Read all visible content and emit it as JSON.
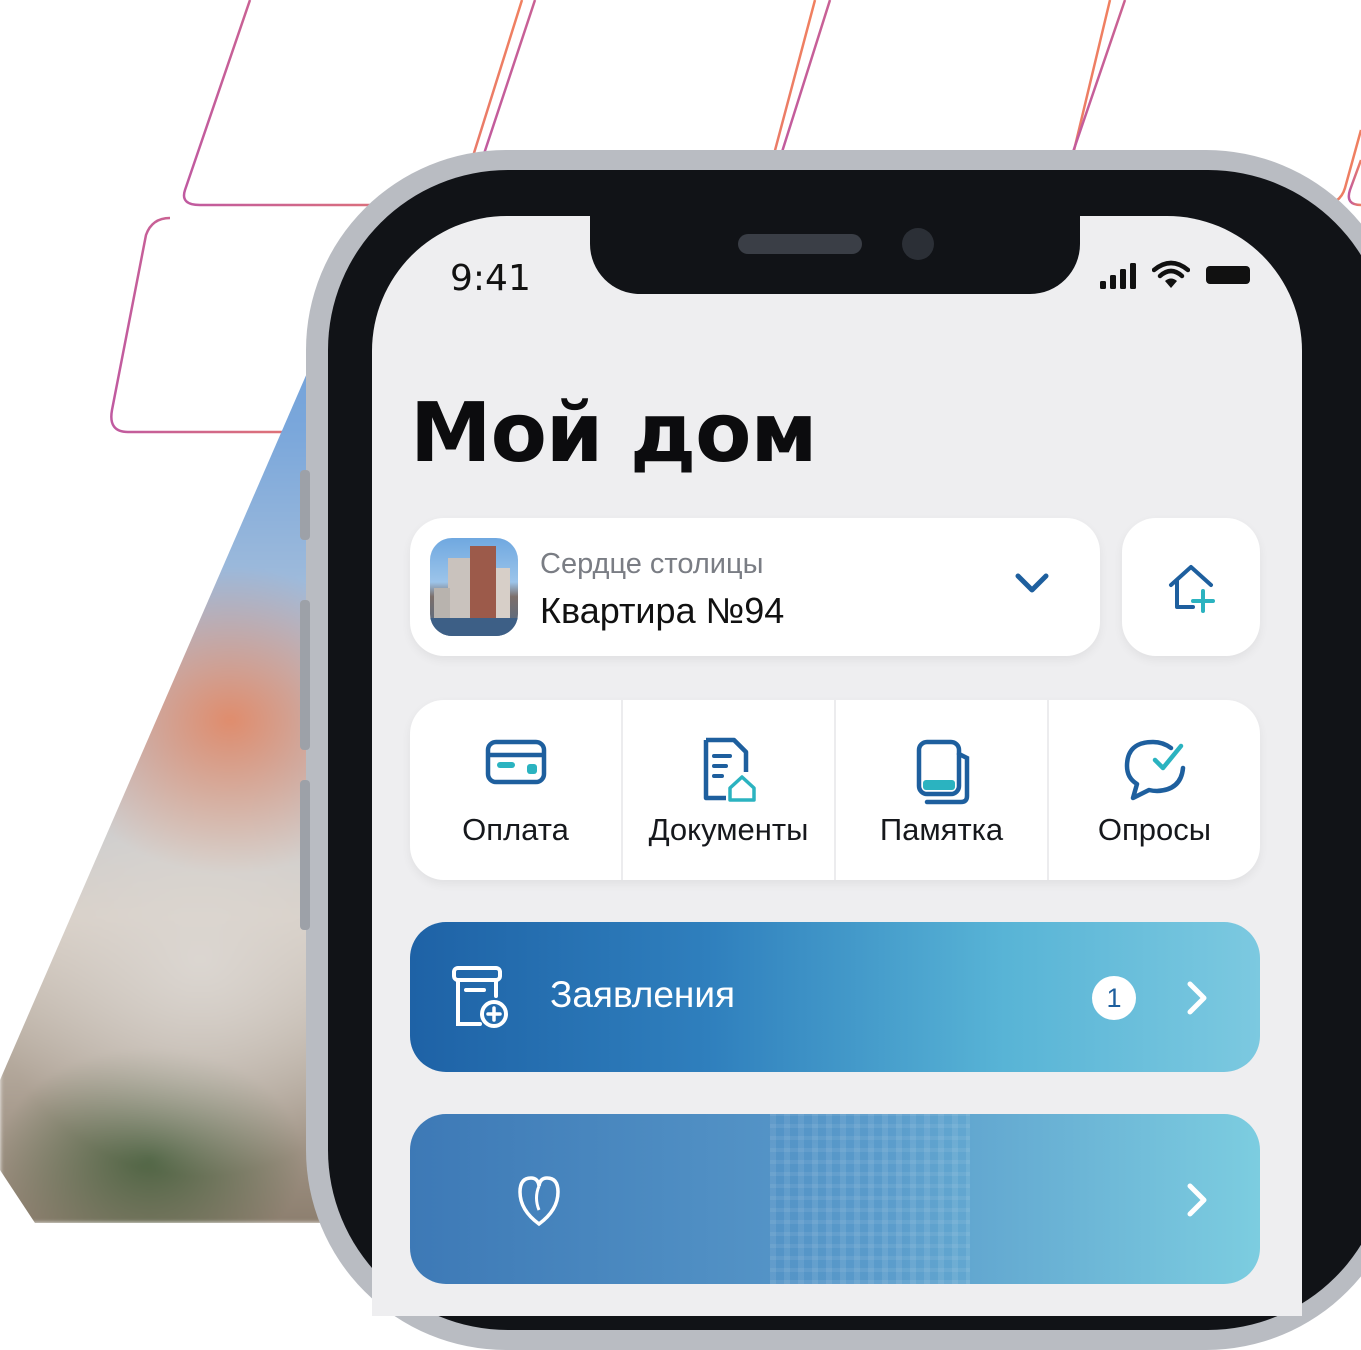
{
  "status_bar": {
    "time": "9:41"
  },
  "page": {
    "title": "Мой дом"
  },
  "apartment": {
    "complex": "Сердце столицы",
    "name": "Квартира №94"
  },
  "quick_actions": [
    {
      "label": "Оплата",
      "icon": "card-icon"
    },
    {
      "label": "Документы",
      "icon": "document-home-icon"
    },
    {
      "label": "Памятка",
      "icon": "memo-icon"
    },
    {
      "label": "Опросы",
      "icon": "poll-chat-icon"
    }
  ],
  "applications": {
    "label": "Заявления",
    "badge": "1"
  },
  "colors": {
    "accent": "#1e5f9e",
    "banner_start": "#1e62a6",
    "banner_end": "#7cc9e0",
    "add_icon_plus": "#2bb3c0"
  }
}
